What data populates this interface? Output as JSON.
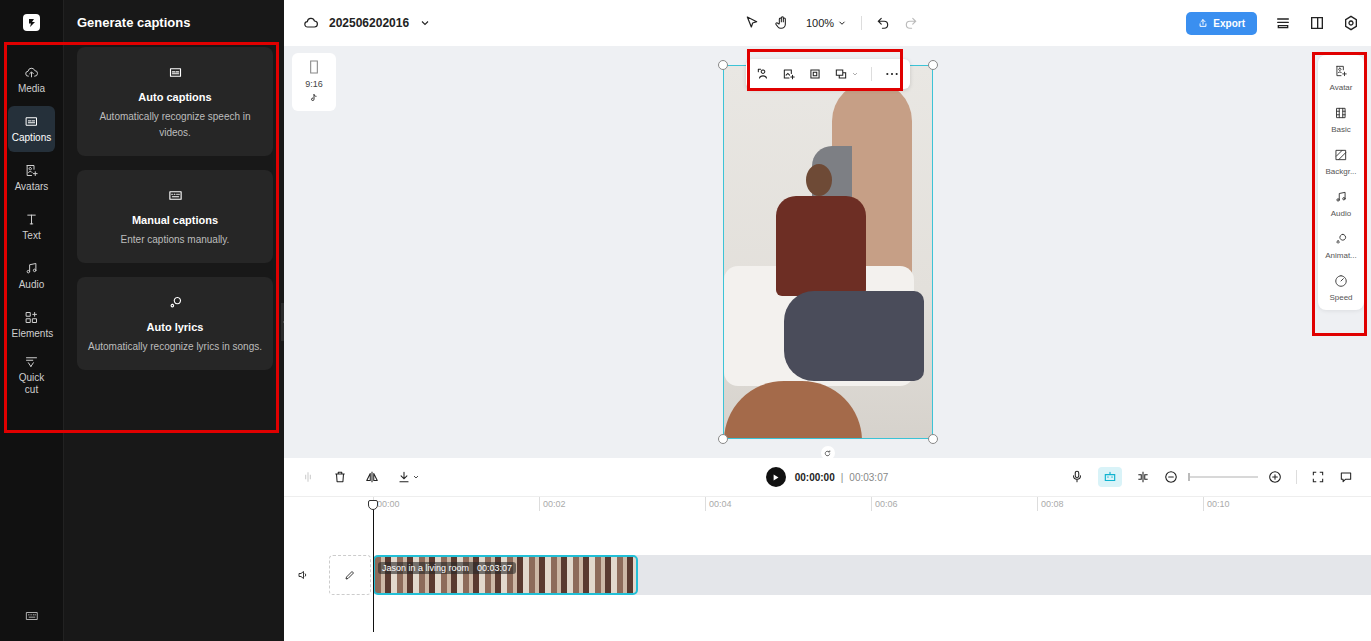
{
  "topbar": {
    "project_name": "202506202016",
    "zoom": "100%",
    "export": "Export"
  },
  "rail": [
    {
      "label": "Media",
      "selected": false
    },
    {
      "label": "Captions",
      "selected": true
    },
    {
      "label": "Avatars",
      "selected": false
    },
    {
      "label": "Text",
      "selected": false
    },
    {
      "label": "Audio",
      "selected": false
    },
    {
      "label": "Elements",
      "selected": false
    },
    {
      "label": "Quick cut",
      "selected": false
    }
  ],
  "panel": {
    "title": "Generate captions",
    "cards": [
      {
        "title": "Auto captions",
        "description": "Automatically recognize speech in videos."
      },
      {
        "title": "Manual captions",
        "description": "Enter captions manually."
      },
      {
        "title": "Auto lyrics",
        "description": "Automatically recognize lyrics in songs."
      }
    ]
  },
  "canvas": {
    "aspect_ratio": "9:16"
  },
  "right_tools": [
    {
      "label": "Avatar"
    },
    {
      "label": "Basic"
    },
    {
      "label": "Backgr..."
    },
    {
      "label": "Audio"
    },
    {
      "label": "Animat..."
    },
    {
      "label": "Speed"
    }
  ],
  "player": {
    "current": "00:00:00",
    "separator": "|",
    "total": "00:03:07"
  },
  "ruler": [
    "00:00",
    "00:02",
    "00:04",
    "00:06",
    "00:08",
    "00:10"
  ],
  "clip": {
    "title": "Jason in a living room",
    "duration": "00:03:07",
    "selected": true
  }
}
